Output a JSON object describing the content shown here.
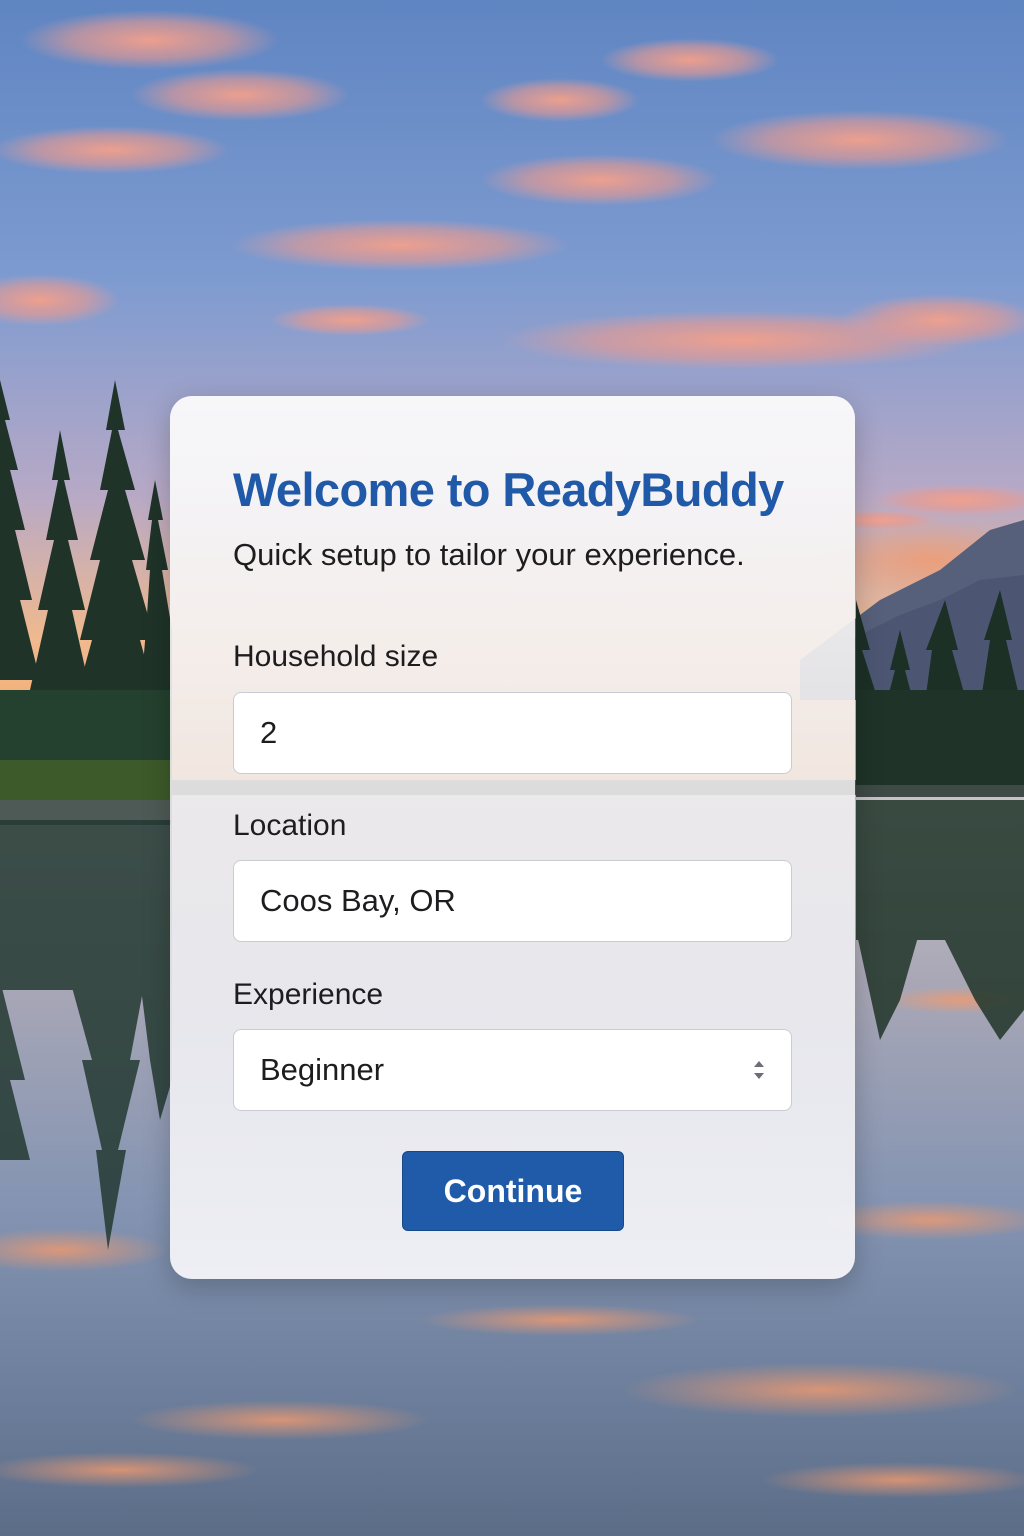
{
  "welcome": {
    "title": "Welcome to ReadyBuddy",
    "subtitle": "Quick setup to tailor your experience."
  },
  "form": {
    "household": {
      "label": "Household size",
      "value": "2"
    },
    "location": {
      "label": "Location",
      "value": "Coos Bay, OR"
    },
    "experience": {
      "label": "Experience",
      "value": "Beginner"
    },
    "continue_label": "Continue"
  },
  "colors": {
    "title": "#1f59a8",
    "button": "#1f5ba8"
  },
  "icons": {
    "select_arrows": "up-down-chevron-icon"
  }
}
